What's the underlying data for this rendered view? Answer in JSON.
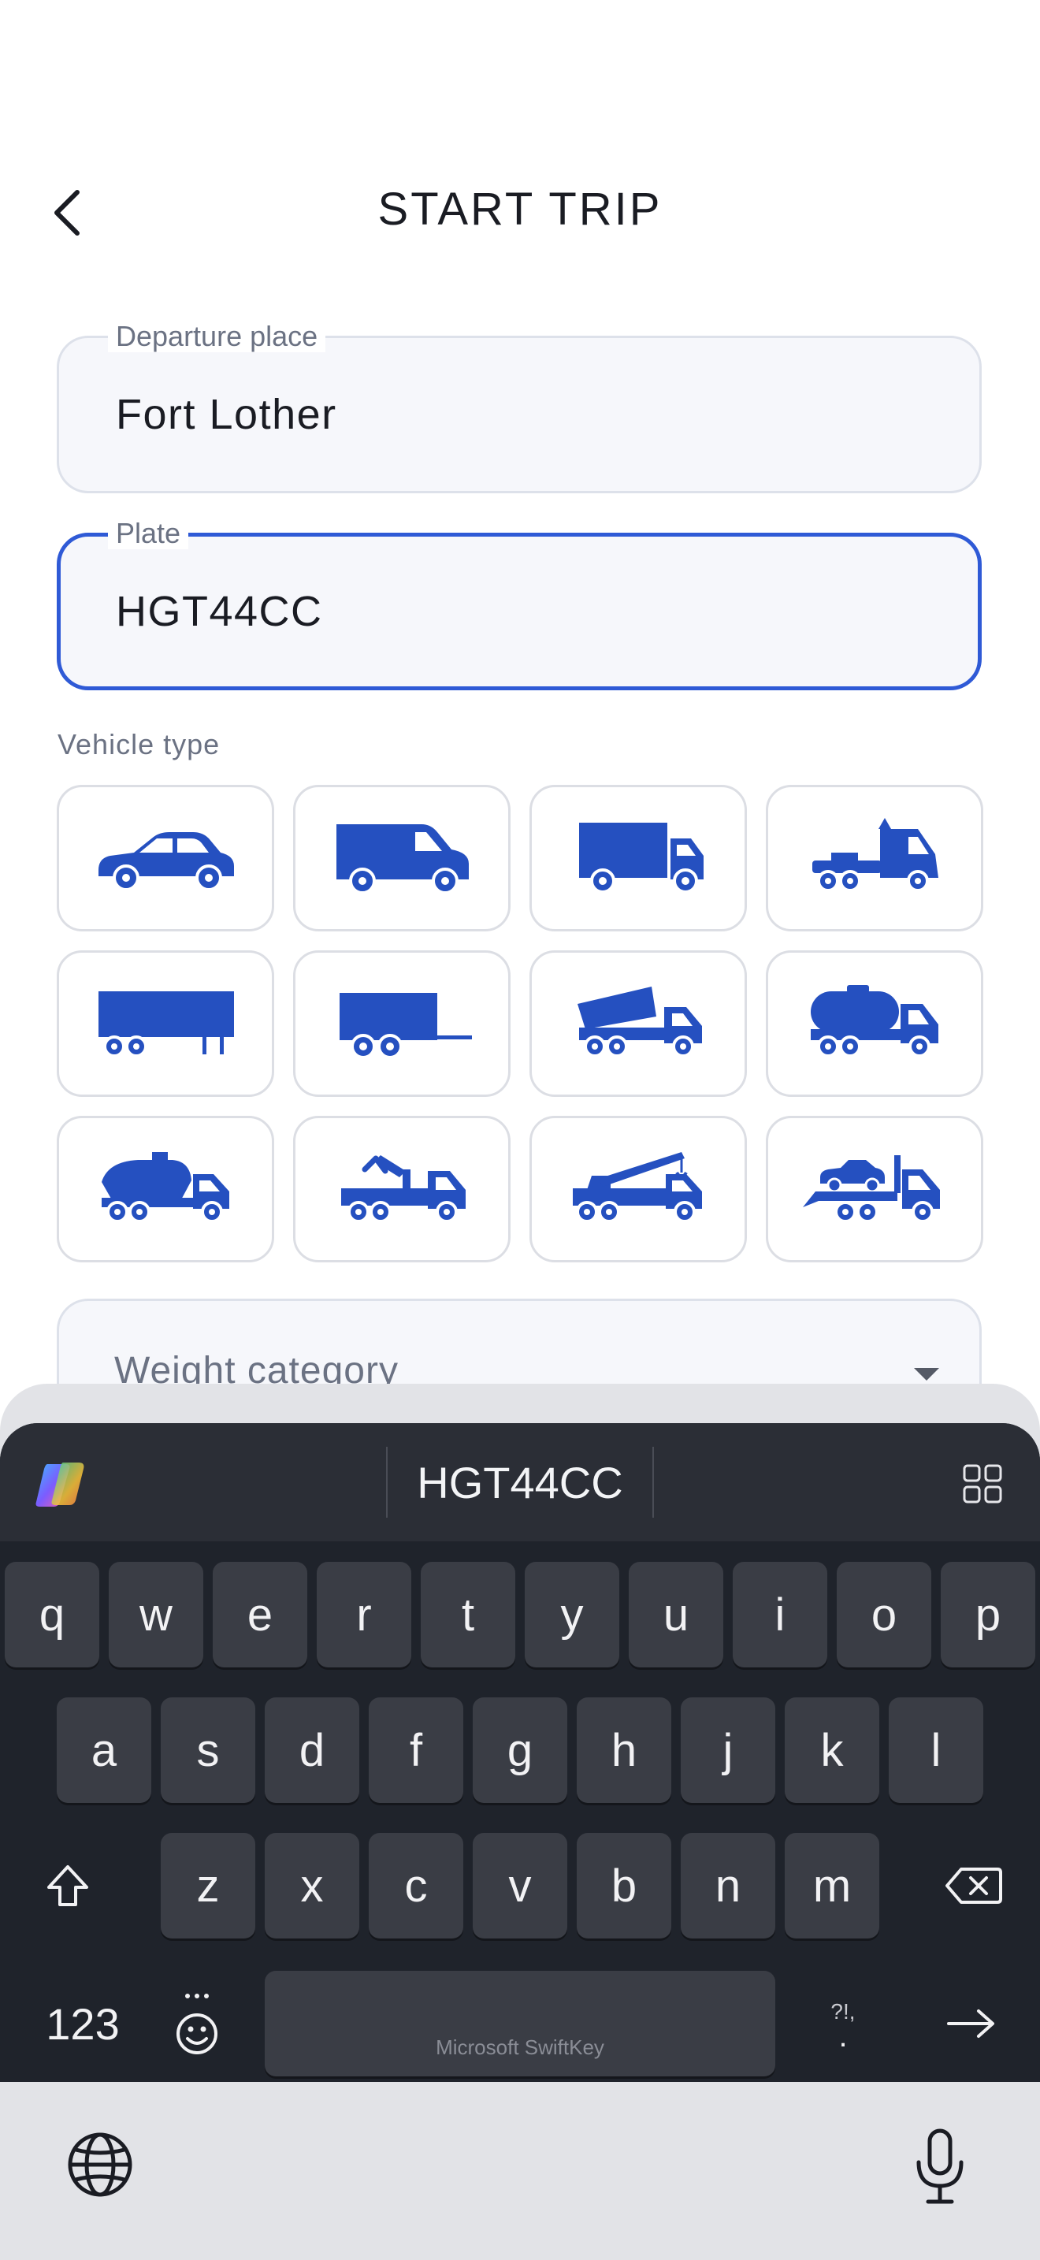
{
  "header": {
    "title": "START TRIP"
  },
  "form": {
    "departure": {
      "label": "Departure place",
      "value": "Fort Lother"
    },
    "plate": {
      "label": "Plate",
      "value": "HGT44CC"
    },
    "vehicle_type_label": "Vehicle type",
    "vehicles": [
      {
        "name": "car"
      },
      {
        "name": "van"
      },
      {
        "name": "box-truck"
      },
      {
        "name": "tractor-unit"
      },
      {
        "name": "semi-trailer"
      },
      {
        "name": "trailer"
      },
      {
        "name": "dump-truck"
      },
      {
        "name": "tanker-truck"
      },
      {
        "name": "bulk-tanker"
      },
      {
        "name": "grapple-truck"
      },
      {
        "name": "crane-truck"
      },
      {
        "name": "tow-truck"
      }
    ],
    "weight_placeholder": "Weight category"
  },
  "colors": {
    "accent": "#2f5ad6",
    "vehicle_icon": "#2550c0",
    "keyboard_bg": "#1f232b"
  },
  "keyboard": {
    "suggestion": "HGT44CC",
    "row1": [
      "q",
      "w",
      "e",
      "r",
      "t",
      "y",
      "u",
      "i",
      "o",
      "p"
    ],
    "row2": [
      "a",
      "s",
      "d",
      "f",
      "g",
      "h",
      "j",
      "k",
      "l"
    ],
    "row3": [
      "z",
      "x",
      "c",
      "v",
      "b",
      "n",
      "m"
    ],
    "numbers_key": "123",
    "punct_key_top": "?!,",
    "punct_key_bottom": ".",
    "space_label": "Microsoft SwiftKey",
    "icons": [
      "copilot-icon",
      "grid-icon",
      "shift-icon",
      "backspace-icon",
      "emoji-icon",
      "enter-arrow-icon",
      "globe-icon",
      "microphone-icon"
    ]
  }
}
